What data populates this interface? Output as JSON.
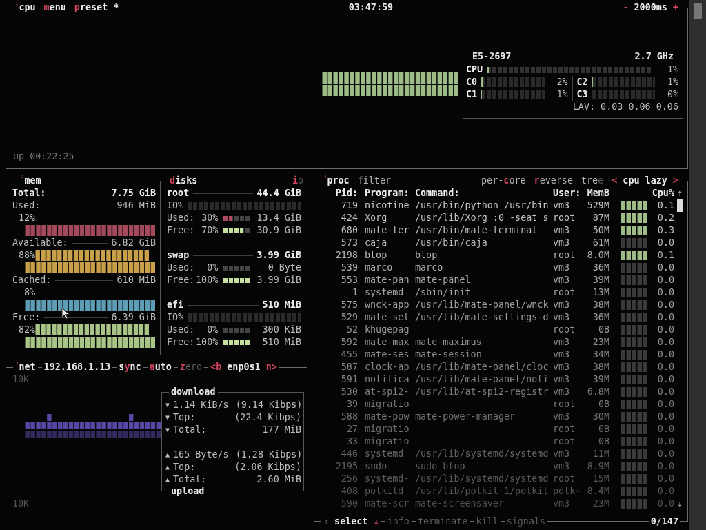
{
  "cpu": {
    "title": [
      {
        "parts": [
          {
            "t": "¹",
            "kind": "index"
          },
          {
            "t": "cpu",
            "kind": "bold"
          }
        ]
      },
      {
        "parts": [
          {
            "t": "m",
            "kind": "key"
          },
          {
            "t": "enu",
            "kind": "bold"
          }
        ]
      },
      {
        "parts": [
          {
            "t": "p",
            "kind": "key"
          },
          {
            "t": "reset *",
            "kind": "bold"
          }
        ]
      }
    ],
    "clock": "03:47:59",
    "interval": {
      "parts": [
        {
          "t": "-",
          "kind": "key"
        },
        {
          "t": " 2000ms ",
          "kind": "bold"
        },
        {
          "t": "+",
          "kind": "key"
        }
      ]
    },
    "model": "E5-2697",
    "freq": "2.7 GHz",
    "total": {
      "label": "CPU",
      "level": 0.01,
      "percent": "1%"
    },
    "cores": [
      {
        "label": "C0",
        "level": 0.02,
        "percent": "2%"
      },
      {
        "label": "C2",
        "level": 0.01,
        "percent": "1%"
      },
      {
        "label": "C1",
        "level": 0.01,
        "percent": "1%"
      },
      {
        "label": "C3",
        "level": 0,
        "percent": "0%"
      }
    ],
    "load": "LAV: 0.03 0.06 0.06",
    "uptime": "up 00:22:25"
  },
  "mem": {
    "title": {
      "parts": [
        {
          "t": "²",
          "kind": "index"
        },
        {
          "t": "mem",
          "kind": "bold"
        }
      ]
    },
    "total": {
      "label": "Total:",
      "value": "7.75 GiB"
    },
    "items": [
      {
        "kind": "single",
        "label": "Used:",
        "value": "946 MiB",
        "percent": "12%",
        "color": "#a34a5a"
      },
      {
        "kind": "double",
        "label": "Available:",
        "value": "6.82 GiB",
        "percent": "88%",
        "color": "#c9a04a"
      },
      {
        "kind": "single",
        "label": "Cached:",
        "value": "610 MiB",
        "percent": "8%",
        "color": "#5d9db5"
      },
      {
        "kind": "double",
        "label": "Free:",
        "value": "6.39 GiB",
        "percent": "82%",
        "color": "#a9c487"
      }
    ]
  },
  "disks": {
    "title": {
      "parts": [
        {
          "t": "d",
          "kind": "key"
        },
        {
          "t": "isks",
          "kind": "bold"
        }
      ]
    },
    "io_toggle": {
      "parts": [
        {
          "t": "i",
          "kind": "key"
        },
        {
          "t": "o",
          "kind": "dim"
        }
      ]
    },
    "list": [
      {
        "name": "root",
        "size": "44.4 GiB",
        "rows": [
          {
            "kind": "io",
            "label": "IO%",
            "level": 0
          },
          {
            "kind": "used",
            "label": "Used:",
            "percent": "30%",
            "level": 0.3,
            "value": "13.4 GiB"
          },
          {
            "kind": "free",
            "label": "Free:",
            "percent": "70%",
            "level": 0.7,
            "value": "30.9 GiB"
          }
        ]
      },
      {
        "name": "swap",
        "size": "3.99 GiB",
        "rows": [
          {
            "kind": "used",
            "label": "Used:",
            "percent": "0%",
            "level": 0,
            "value": "0 Byte"
          },
          {
            "kind": "free",
            "label": "Free:",
            "percent": "100%",
            "level": 1,
            "value": "3.99 GiB"
          }
        ]
      },
      {
        "name": "efi",
        "size": "510 MiB",
        "rows": [
          {
            "kind": "io",
            "label": "IO%",
            "level": 0
          },
          {
            "kind": "used",
            "label": "Used:",
            "percent": "0%",
            "level": 0,
            "value": "300 KiB"
          },
          {
            "kind": "free",
            "label": "Free:",
            "percent": "100%",
            "level": 1,
            "value": "510 MiB"
          }
        ]
      }
    ]
  },
  "net": {
    "title": [
      {
        "parts": [
          {
            "t": "³",
            "kind": "index"
          },
          {
            "t": "net",
            "kind": "bold"
          }
        ]
      },
      {
        "parts": [
          {
            "t": "192.168.1.13",
            "kind": "bold"
          }
        ]
      },
      {
        "parts": [
          {
            "t": "s",
            "kind": "bold"
          },
          {
            "t": "y",
            "kind": "key"
          },
          {
            "t": "nc",
            "kind": "bold"
          }
        ]
      },
      {
        "parts": [
          {
            "t": "a",
            "kind": "key"
          },
          {
            "t": "uto",
            "kind": "bold"
          }
        ]
      },
      {
        "parts": [
          {
            "t": "z",
            "kind": "key"
          },
          {
            "t": "ero",
            "kind": "dim"
          }
        ]
      },
      {
        "parts": [
          {
            "t": "<b",
            "kind": "key"
          },
          {
            "t": " enp0s1 ",
            "kind": "bold"
          },
          {
            "t": "n>",
            "kind": "key"
          }
        ]
      }
    ],
    "scale_top": "10K",
    "scale_bottom": "10K",
    "download": {
      "title": "download",
      "rows": [
        {
          "arrow": "▼",
          "label": "1.14 KiB/s",
          "value": "(9.14 Kibps)"
        },
        {
          "arrow": "▼",
          "label": "Top:",
          "value": "(22.4 Kibps)"
        },
        {
          "arrow": "▼",
          "label": "Total:",
          "value": "177 MiB"
        }
      ]
    },
    "upload": {
      "title": "upload",
      "rows": [
        {
          "arrow": "▲",
          "label": "165 Byte/s",
          "value": "(1.28 Kibps)"
        },
        {
          "arrow": "▲",
          "label": "Top:",
          "value": "(2.06 Kibps)"
        },
        {
          "arrow": "▲",
          "label": "Total:",
          "value": "2.60 MiB"
        }
      ]
    }
  },
  "proc": {
    "title": [
      {
        "parts": [
          {
            "t": "⁴",
            "kind": "index"
          },
          {
            "t": "proc",
            "kind": "bold"
          }
        ]
      },
      {
        "parts": [
          {
            "t": "f",
            "kind": "dim"
          },
          {
            "t": "ilter",
            "kind": "plain"
          }
        ]
      }
    ],
    "options": [
      {
        "parts": [
          {
            "t": "per-",
            "kind": "plain"
          },
          {
            "t": "c",
            "kind": "key"
          },
          {
            "t": "ore",
            "kind": "plain"
          }
        ]
      },
      {
        "parts": [
          {
            "t": "r",
            "kind": "key"
          },
          {
            "t": "everse",
            "kind": "plain"
          }
        ]
      },
      {
        "parts": [
          {
            "t": "tre",
            "kind": "plain"
          },
          {
            "t": "e",
            "kind": "dim"
          }
        ]
      },
      {
        "parts": [
          {
            "t": "<",
            "kind": "key"
          },
          {
            "t": " cpu lazy ",
            "kind": "bold"
          },
          {
            "t": ">",
            "kind": "key"
          }
        ]
      }
    ],
    "columns": [
      "Pid:",
      "Program:",
      "Command:",
      "User:",
      "MemB",
      "Cpu%"
    ],
    "rows": [
      {
        "pid": "719",
        "program": "nicotine",
        "command": "/usr/bin/python /usr/bin",
        "user": "vm3",
        "mem": "529M",
        "cpu": "0.1"
      },
      {
        "pid": "424",
        "program": "Xorg",
        "command": "/usr/lib/Xorg :0 -seat s",
        "user": "root",
        "mem": "87M",
        "cpu": "0.2"
      },
      {
        "pid": "680",
        "program": "mate-ter",
        "command": "/usr/bin/mate-terminal",
        "user": "vm3",
        "mem": "50M",
        "cpu": "0.3"
      },
      {
        "pid": "573",
        "program": "caja",
        "command": "/usr/bin/caja",
        "user": "vm3",
        "mem": "61M",
        "cpu": "0.0"
      },
      {
        "pid": "2198",
        "program": "btop",
        "command": "btop",
        "user": "root",
        "mem": "8.0M",
        "cpu": "0.1"
      },
      {
        "pid": "539",
        "program": "marco",
        "command": "marco",
        "user": "vm3",
        "mem": "36M",
        "cpu": "0.0"
      },
      {
        "pid": "553",
        "program": "mate-pan",
        "command": "mate-panel",
        "user": "vm3",
        "mem": "39M",
        "cpu": "0.0"
      },
      {
        "pid": "1",
        "program": "systemd",
        "command": "/sbin/init",
        "user": "root",
        "mem": "13M",
        "cpu": "0.0"
      },
      {
        "pid": "575",
        "program": "wnck-app",
        "command": "/usr/lib/mate-panel/wnck",
        "user": "vm3",
        "mem": "38M",
        "cpu": "0.0"
      },
      {
        "pid": "529",
        "program": "mate-set",
        "command": "/usr/lib/mate-settings-d",
        "user": "vm3",
        "mem": "36M",
        "cpu": "0.0"
      },
      {
        "pid": "52",
        "program": "khugepag",
        "command": "",
        "user": "root",
        "mem": "0B",
        "cpu": "0.0"
      },
      {
        "pid": "592",
        "program": "mate-max",
        "command": "mate-maximus",
        "user": "vm3",
        "mem": "23M",
        "cpu": "0.0"
      },
      {
        "pid": "455",
        "program": "mate-ses",
        "command": "mate-session",
        "user": "vm3",
        "mem": "34M",
        "cpu": "0.0"
      },
      {
        "pid": "587",
        "program": "clock-ap",
        "command": "/usr/lib/mate-panel/cloc",
        "user": "vm3",
        "mem": "38M",
        "cpu": "0.0"
      },
      {
        "pid": "591",
        "program": "notifica",
        "command": "/usr/lib/mate-panel/noti",
        "user": "vm3",
        "mem": "39M",
        "cpu": "0.0"
      },
      {
        "pid": "530",
        "program": "at-spi2-",
        "command": "/usr/lib/at-spi2-registr",
        "user": "vm3",
        "mem": "6.8M",
        "cpu": "0.0"
      },
      {
        "pid": "39",
        "program": "migratio",
        "command": "",
        "user": "root",
        "mem": "0B",
        "cpu": "0.0"
      },
      {
        "pid": "588",
        "program": "mate-pow",
        "command": "mate-power-manager",
        "user": "vm3",
        "mem": "30M",
        "cpu": "0.0"
      },
      {
        "pid": "27",
        "program": "migratio",
        "command": "",
        "user": "root",
        "mem": "0B",
        "cpu": "0.0"
      },
      {
        "pid": "33",
        "program": "migratio",
        "command": "",
        "user": "root",
        "mem": "0B",
        "cpu": "0.0"
      },
      {
        "pid": "446",
        "program": "systemd",
        "command": "/usr/lib/systemd/systemd",
        "user": "vm3",
        "mem": "11M",
        "cpu": "0.0"
      },
      {
        "pid": "2195",
        "program": "sudo",
        "command": "sudo btop",
        "user": "vm3",
        "mem": "8.9M",
        "cpu": "0.0"
      },
      {
        "pid": "256",
        "program": "systemd-",
        "command": "/usr/lib/systemd/systemd",
        "user": "root",
        "mem": "15M",
        "cpu": "0.0"
      },
      {
        "pid": "408",
        "program": "polkitd",
        "command": "/usr/lib/polkit-1/polkit",
        "user": "polk+",
        "mem": "8.4M",
        "cpu": "0.0"
      },
      {
        "pid": "590",
        "program": "mate-scr",
        "command": "mate-screensaver",
        "user": "vm3",
        "mem": "23M",
        "cpu": "0.0"
      }
    ],
    "scroll": {
      "up": "↑",
      "down": "↓"
    },
    "footer": [
      {
        "parts": [
          {
            "t": "↑",
            "kind": "dim"
          },
          {
            "t": " select ",
            "kind": "bold"
          },
          {
            "t": "↓",
            "kind": "key"
          }
        ]
      },
      {
        "parts": [
          {
            "t": "info",
            "kind": "dim"
          }
        ]
      },
      {
        "parts": [
          {
            "t": "terminate",
            "kind": "dim"
          }
        ]
      },
      {
        "parts": [
          {
            "t": "kill",
            "kind": "dim"
          }
        ]
      },
      {
        "parts": [
          {
            "t": "signals",
            "kind": "dim"
          }
        ]
      }
    ],
    "count": "0/147"
  }
}
